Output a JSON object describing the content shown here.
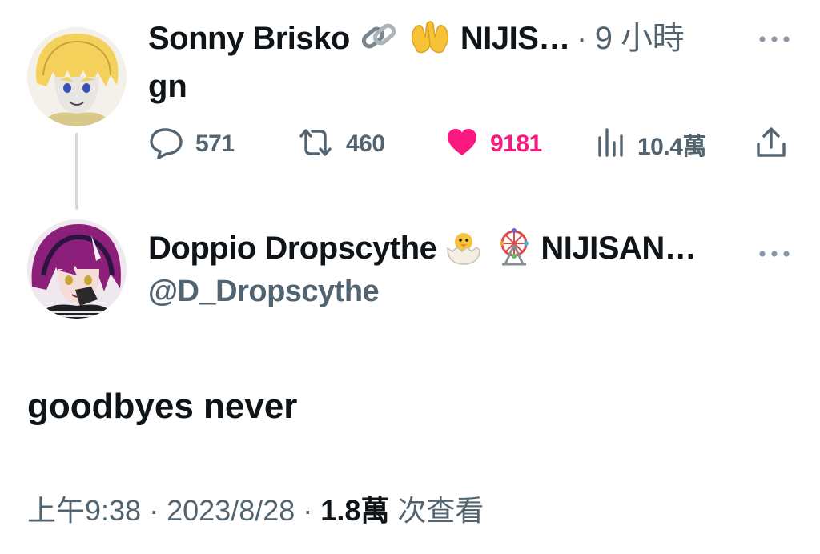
{
  "reply_parent": {
    "display_name": "Sonny Brisko",
    "name_suffix": "NIJIS…",
    "separator": "·",
    "time_ago": "9 小時",
    "text": "gn",
    "actions": {
      "replies": "571",
      "retweets": "460",
      "likes": "9181",
      "views": "10.4萬"
    },
    "icons": [
      "link-emoji-icon",
      "raising-hands-emoji-icon"
    ]
  },
  "main_tweet": {
    "display_name": "Doppio Dropscythe",
    "name_suffix": "NIJISAN…",
    "handle": "@D_Dropscythe",
    "text": "goodbyes never",
    "icons": [
      "hatching-chick-emoji-icon",
      "ferris-wheel-emoji-icon"
    ]
  },
  "footer": {
    "time": "上午9:38",
    "sep1": "·",
    "date": "2023/8/28",
    "sep2": "·",
    "views_count": "1.8萬",
    "views_label": "次查看"
  },
  "colors": {
    "text": "#0f1419",
    "muted": "#536471",
    "like": "#f91880",
    "thread_line": "#cfd9de"
  }
}
